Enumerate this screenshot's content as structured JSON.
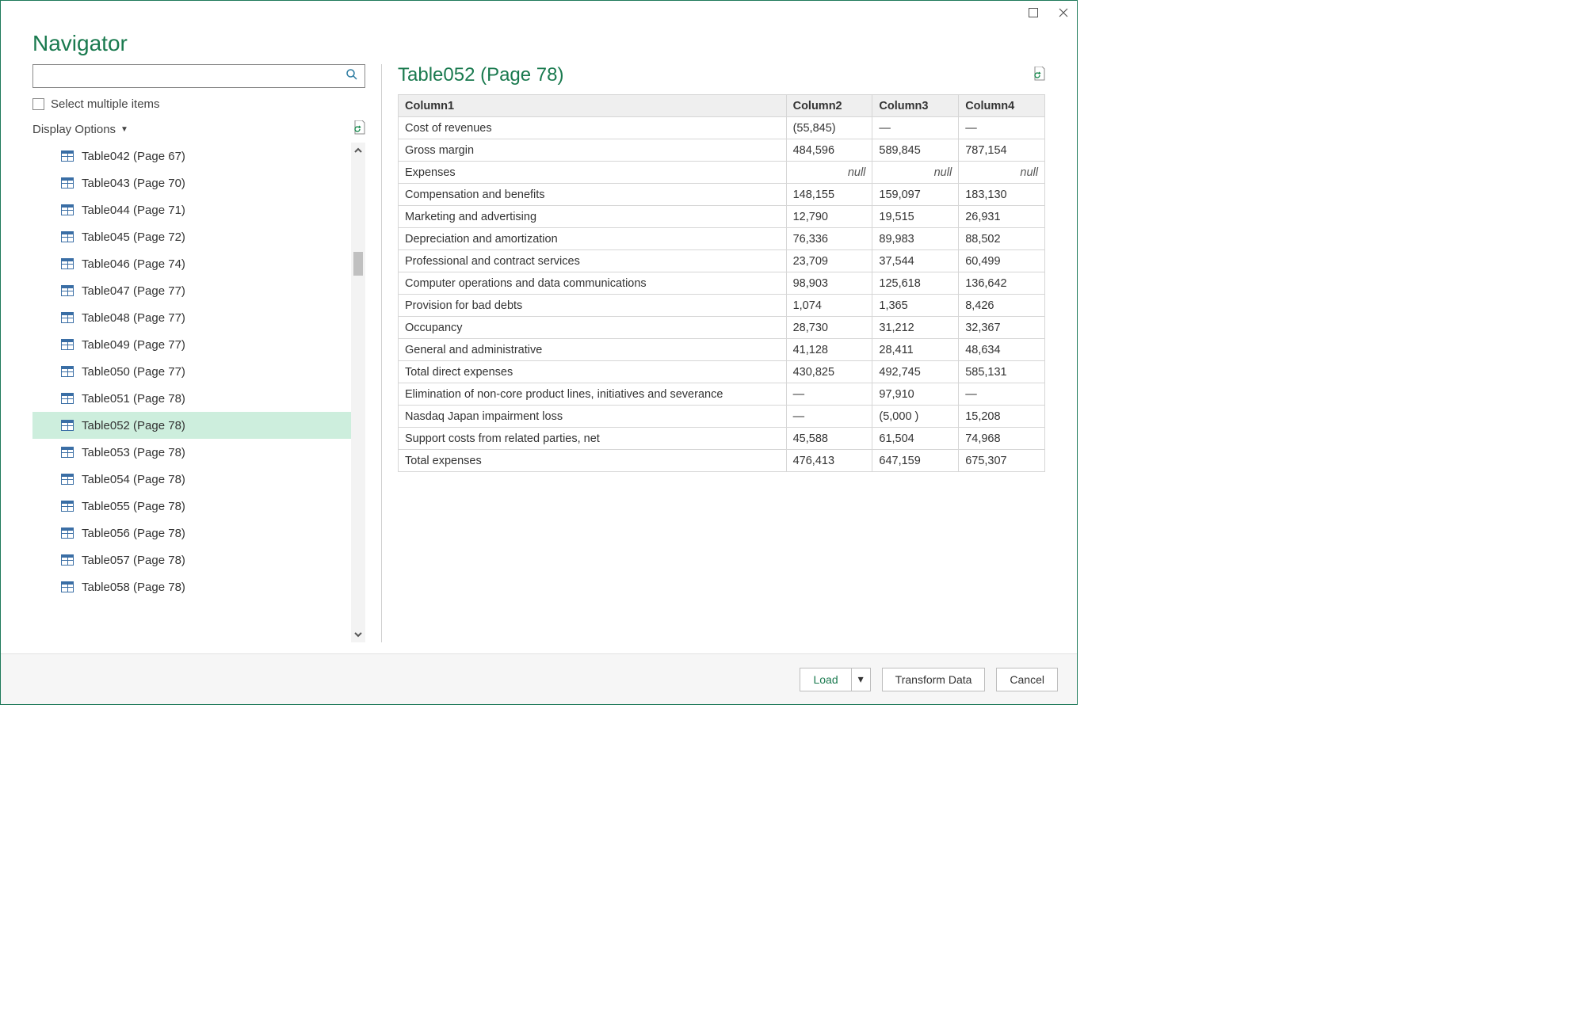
{
  "window_title": "Navigator",
  "checkbox_label": "Select multiple items",
  "display_options_label": "Display Options",
  "tree_items": [
    {
      "label": "Table042 (Page 67)",
      "selected": false
    },
    {
      "label": "Table043 (Page 70)",
      "selected": false
    },
    {
      "label": "Table044 (Page 71)",
      "selected": false
    },
    {
      "label": "Table045 (Page 72)",
      "selected": false
    },
    {
      "label": "Table046 (Page 74)",
      "selected": false
    },
    {
      "label": "Table047 (Page 77)",
      "selected": false
    },
    {
      "label": "Table048 (Page 77)",
      "selected": false
    },
    {
      "label": "Table049 (Page 77)",
      "selected": false
    },
    {
      "label": "Table050 (Page 77)",
      "selected": false
    },
    {
      "label": "Table051 (Page 78)",
      "selected": false
    },
    {
      "label": "Table052 (Page 78)",
      "selected": true
    },
    {
      "label": "Table053 (Page 78)",
      "selected": false
    },
    {
      "label": "Table054 (Page 78)",
      "selected": false
    },
    {
      "label": "Table055 (Page 78)",
      "selected": false
    },
    {
      "label": "Table056 (Page 78)",
      "selected": false
    },
    {
      "label": "Table057 (Page 78)",
      "selected": false
    },
    {
      "label": "Table058 (Page 78)",
      "selected": false
    }
  ],
  "preview": {
    "title": "Table052 (Page 78)",
    "columns": [
      "Column1",
      "Column2",
      "Column3",
      "Column4"
    ],
    "rows": [
      [
        "Cost of revenues",
        "(55,845)",
        "—",
        "—"
      ],
      [
        "Gross margin",
        "484,596",
        "589,845",
        "787,154"
      ],
      [
        "Expenses",
        null,
        null,
        null
      ],
      [
        "Compensation and benefits",
        "148,155",
        "159,097",
        "183,130"
      ],
      [
        "Marketing and advertising",
        "12,790",
        "19,515",
        "26,931"
      ],
      [
        "Depreciation and amortization",
        "76,336",
        "89,983",
        "88,502"
      ],
      [
        "Professional and contract services",
        "23,709",
        "37,544",
        "60,499"
      ],
      [
        "Computer operations and data communications",
        "98,903",
        "125,618",
        "136,642"
      ],
      [
        "Provision for bad debts",
        "1,074",
        "1,365",
        "8,426"
      ],
      [
        "Occupancy",
        "28,730",
        "31,212",
        "32,367"
      ],
      [
        "General and administrative",
        "41,128",
        "28,411",
        "48,634"
      ],
      [
        "Total direct expenses",
        "430,825",
        "492,745",
        "585,131"
      ],
      [
        "Elimination of non-core product lines, initiatives and severance",
        "—",
        "97,910",
        "—"
      ],
      [
        "Nasdaq Japan impairment loss",
        "—",
        "(5,000 )",
        "15,208"
      ],
      [
        "Support costs from related parties, net",
        "45,588",
        "61,504",
        "74,968"
      ],
      [
        "Total expenses",
        "476,413",
        "647,159",
        "675,307"
      ]
    ],
    "null_text": "null"
  },
  "footer": {
    "load": "Load",
    "transform": "Transform Data",
    "cancel": "Cancel",
    "drop_caret": "▾"
  }
}
